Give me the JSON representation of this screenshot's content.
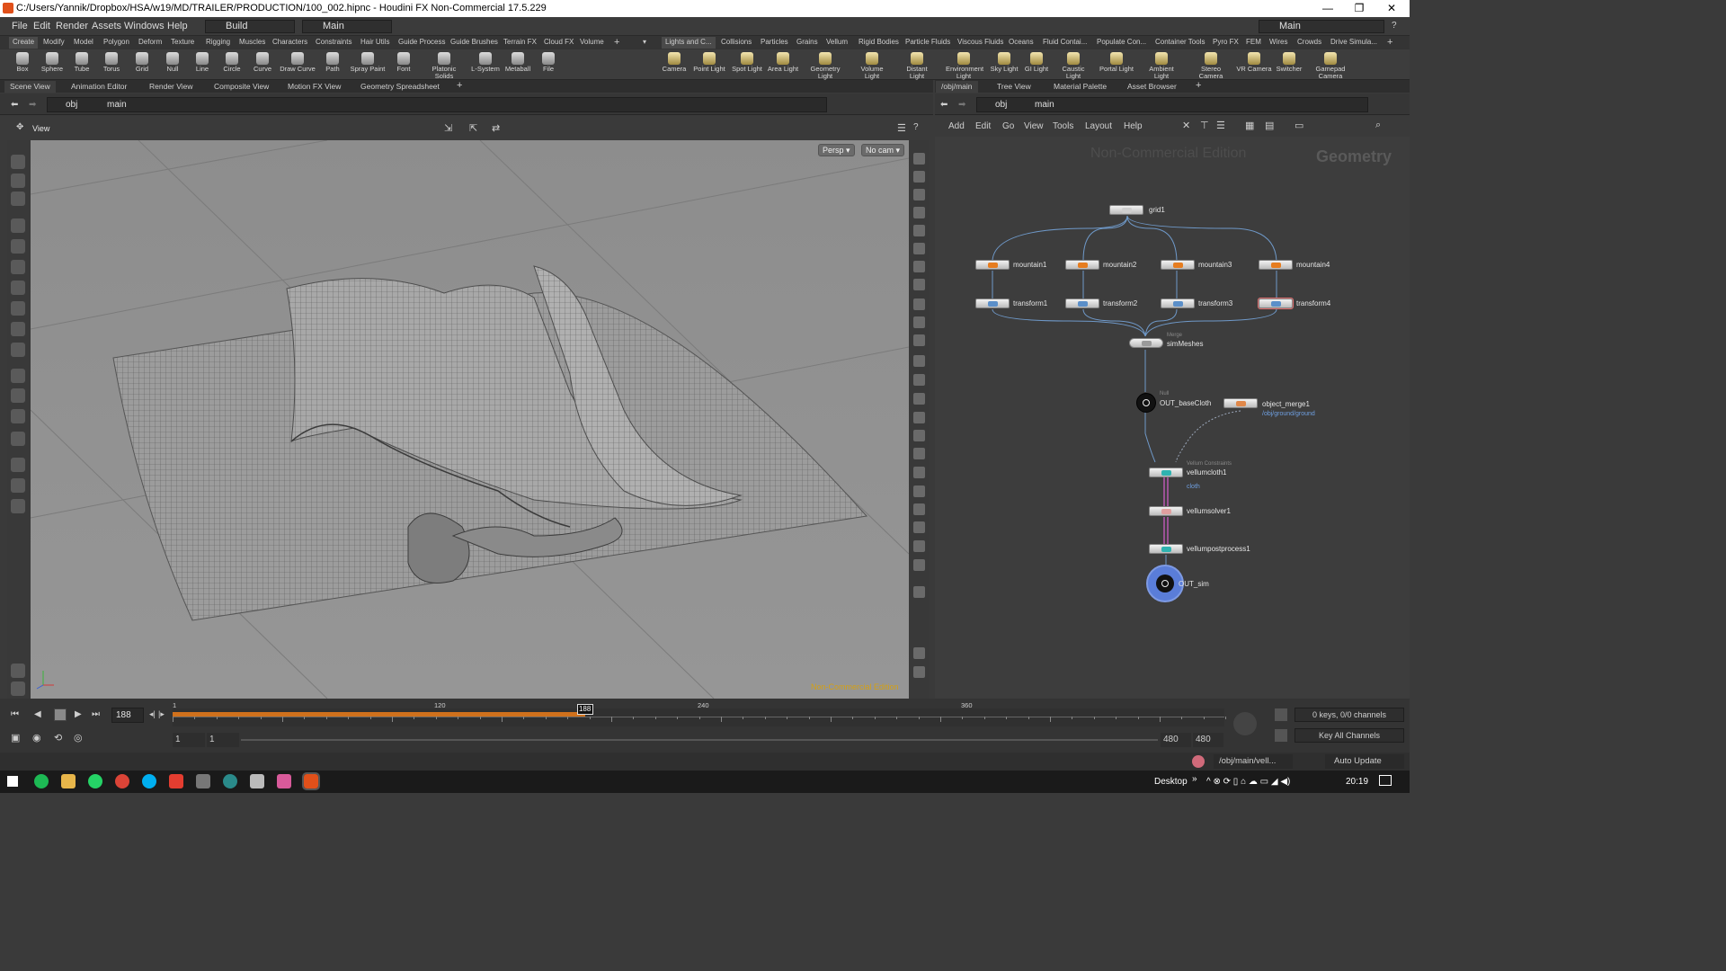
{
  "window": {
    "title": "C:/Users/Yannik/Dropbox/HSA/w19/MD/TRAILER/PRODUCTION/100_002.hipnc - Houdini FX Non-Commercial 17.5.229",
    "minimize": "—",
    "maximize": "❐",
    "close": "✕"
  },
  "menubar": {
    "items": [
      "File",
      "Edit",
      "Render",
      "Assets",
      "Windows",
      "Help"
    ],
    "desktop": "Build",
    "context": "Main",
    "right_context": "Main",
    "help_icon": "?"
  },
  "shelf_tabs_left": [
    "Create",
    "Modify",
    "Model",
    "Polygon",
    "Deform",
    "Texture",
    "Rigging",
    "Muscles",
    "Characters",
    "Constraints",
    "Hair Utils",
    "Guide Process",
    "Guide Brushes",
    "Terrain FX",
    "Cloud FX",
    "Volume"
  ],
  "shelf_tabs_right": [
    "Lights and C...",
    "Collisions",
    "Particles",
    "Grains",
    "Vellum",
    "Rigid Bodies",
    "Particle Fluids",
    "Viscous Fluids",
    "Oceans",
    "Fluid Contai...",
    "Populate Con...",
    "Container Tools",
    "Pyro FX",
    "FEM",
    "Wires",
    "Crowds",
    "Drive Simula..."
  ],
  "tools_left": [
    "Box",
    "Sphere",
    "Tube",
    "Torus",
    "Grid",
    "Null",
    "Line",
    "Circle",
    "Curve",
    "Draw Curve",
    "Path",
    "Spray Paint",
    "Font",
    "Platonic Solids",
    "L-System",
    "Metaball",
    "File"
  ],
  "tools_right": [
    "Camera",
    "Point Light",
    "Spot Light",
    "Area Light",
    "Geometry Light",
    "Volume Light",
    "Distant Light",
    "Environment Light",
    "Sky Light",
    "GI Light",
    "Caustic Light",
    "Portal Light",
    "Ambient Light",
    "Stereo Camera",
    "VR Camera",
    "Switcher",
    "Gamepad Camera"
  ],
  "left_pane_tabs": [
    "Scene View",
    "Animation Editor",
    "Render View",
    "Composite View",
    "Motion FX View",
    "Geometry Spreadsheet"
  ],
  "right_pane_tabs": [
    "/obj/main",
    "Tree View",
    "Material Palette",
    "Asset Browser"
  ],
  "left_path": {
    "obj": "obj",
    "node": "main"
  },
  "right_path": {
    "obj": "obj",
    "node": "main"
  },
  "viewer": {
    "label": "View",
    "persp": "Persp ▾",
    "cam": "No cam ▾",
    "watermark": "Non-Commercial Edition"
  },
  "network": {
    "menu": [
      "Add",
      "Edit",
      "Go",
      "View",
      "Tools",
      "Layout",
      "Help"
    ],
    "watermark": "Non-Commercial Edition",
    "context_label": "Geometry",
    "nodes": {
      "grid1": "grid1",
      "mountain1": "mountain1",
      "mountain2": "mountain2",
      "mountain3": "mountain3",
      "mountain4": "mountain4",
      "transform1": "transform1",
      "transform2": "transform2",
      "transform3": "transform3",
      "transform4": "transform4",
      "merge_type": "Merge",
      "merge": "simMeshes",
      "null_type": "Null",
      "null": "OUT_baseCloth",
      "objmerge": "object_merge1",
      "objmerge_param": "/obj/ground/ground",
      "vc_type": "Vellum Constraints",
      "vc": "vellumcloth1",
      "vc_param": "cloth",
      "solver": "vellumsolver1",
      "post": "vellumpostprocess1",
      "out": "OUT_sim"
    }
  },
  "timeline": {
    "frame": "188",
    "current_marker": "188",
    "ticks": [
      "1",
      "120",
      "240",
      "360"
    ],
    "range_start": "1",
    "range_start2": "1",
    "range_end": "480",
    "range_end2": "480",
    "keys": "0 keys, 0/0 channels",
    "key_all": "Key All Channels",
    "playhead_fraction": 0.392
  },
  "statusbar": {
    "path": "/obj/main/vell...",
    "update": "Auto Update"
  },
  "taskbar": {
    "desktop": "Desktop",
    "time": "20:19",
    "chevron": "»"
  },
  "colors": {
    "accent": "#e8801a",
    "timeline_range": "#d0711c",
    "selected_node": "#5a7dd8"
  }
}
